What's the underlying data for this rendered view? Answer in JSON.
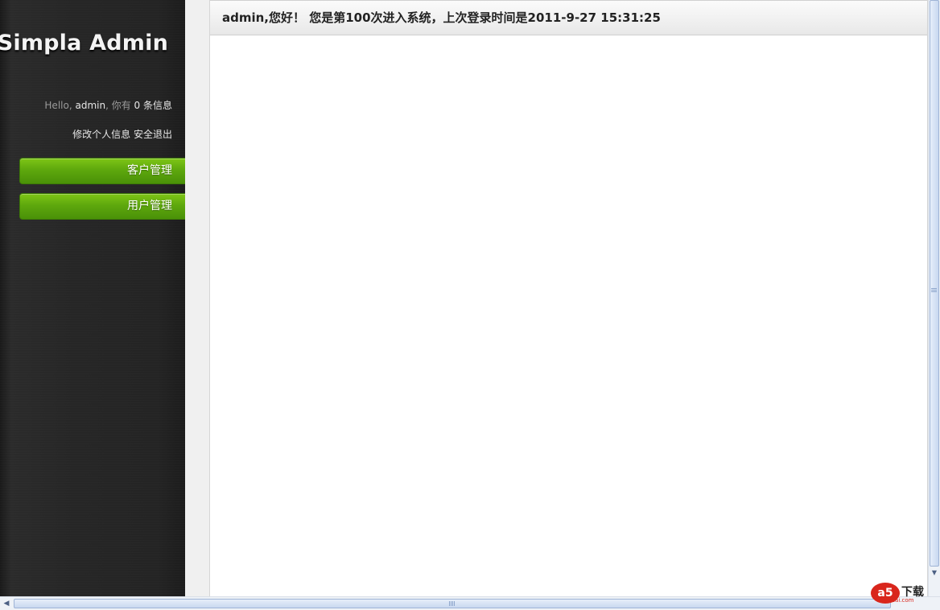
{
  "sidebar": {
    "logo": "Simpla Admin",
    "profile": {
      "hello": "Hello,",
      "username": "admin",
      "you_have": ", 你有",
      "message_count": "0 条信息"
    },
    "links": {
      "edit_profile": "修改个人信息",
      "logout": "安全退出"
    },
    "nav": [
      {
        "label": "客户管理"
      },
      {
        "label": "用户管理"
      }
    ]
  },
  "main": {
    "welcome": "admin,您好！ 您是第100次进入系统，上次登录时间是2011-9-27 15:31:25"
  },
  "watermark": {
    "logo": "a5",
    "text": "下载",
    "sub": "xiazai.com"
  },
  "colors": {
    "sidebar_bg": "#242424",
    "nav_green": "#5ea80d",
    "watermark_red": "#d9261c"
  }
}
